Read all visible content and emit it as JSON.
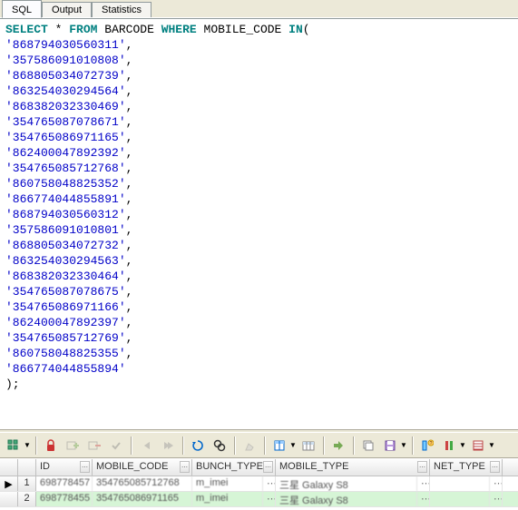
{
  "tabs": {
    "sql": "SQL",
    "output": "Output",
    "statistics": "Statistics"
  },
  "sql": {
    "keywords": {
      "select": "SELECT",
      "from": "FROM",
      "where": "WHERE",
      "in": "IN"
    },
    "star": "*",
    "table": "BARCODE",
    "column": "MOBILE_CODE",
    "lparen": "(",
    "rparen": ")",
    "semicolon": ";",
    "comma": ",",
    "values": [
      "868794030560311",
      "357586091010808",
      "868805034072739",
      "863254030294564",
      "868382032330469",
      "354765087078671",
      "354765086971165",
      "862400047892392",
      "354765085712768",
      "860758048825352",
      "866774044855891",
      "868794030560312",
      "357586091010801",
      "868805034072732",
      "863254030294563",
      "868382032330464",
      "354765087078675",
      "354765086971166",
      "862400047892397",
      "354765085712769",
      "860758048825355",
      "866774044855894"
    ]
  },
  "grid": {
    "columns": {
      "id": "ID",
      "mobile_code": "MOBILE_CODE",
      "bunch_type": "BUNCH_TYPE",
      "mobile_type": "MOBILE_TYPE",
      "net_type": "NET_TYPE"
    },
    "rows": [
      {
        "n": "1",
        "id": "698778457",
        "mobile_code": "354765085712768",
        "bunch_type": "m_imei",
        "mobile_type": "三星 Galaxy S8",
        "net_type": ""
      },
      {
        "n": "2",
        "id": "698778455",
        "mobile_code": "354765086971165",
        "bunch_type": "m_imei",
        "mobile_type": "三星 Galaxy S8",
        "net_type": ""
      }
    ]
  },
  "toolbar": {
    "grid_mode": "grid-mode",
    "lock": "lock",
    "add": "add-row",
    "delete": "delete-row",
    "post": "post",
    "first": "first",
    "last": "last",
    "refresh": "refresh",
    "find": "find",
    "clear": "clear",
    "export1": "export",
    "export2": "export-table",
    "nav": "navigate",
    "copy": "copy",
    "save": "save",
    "info": "column-info",
    "filter": "toggle-filter",
    "detail": "detail-view"
  }
}
